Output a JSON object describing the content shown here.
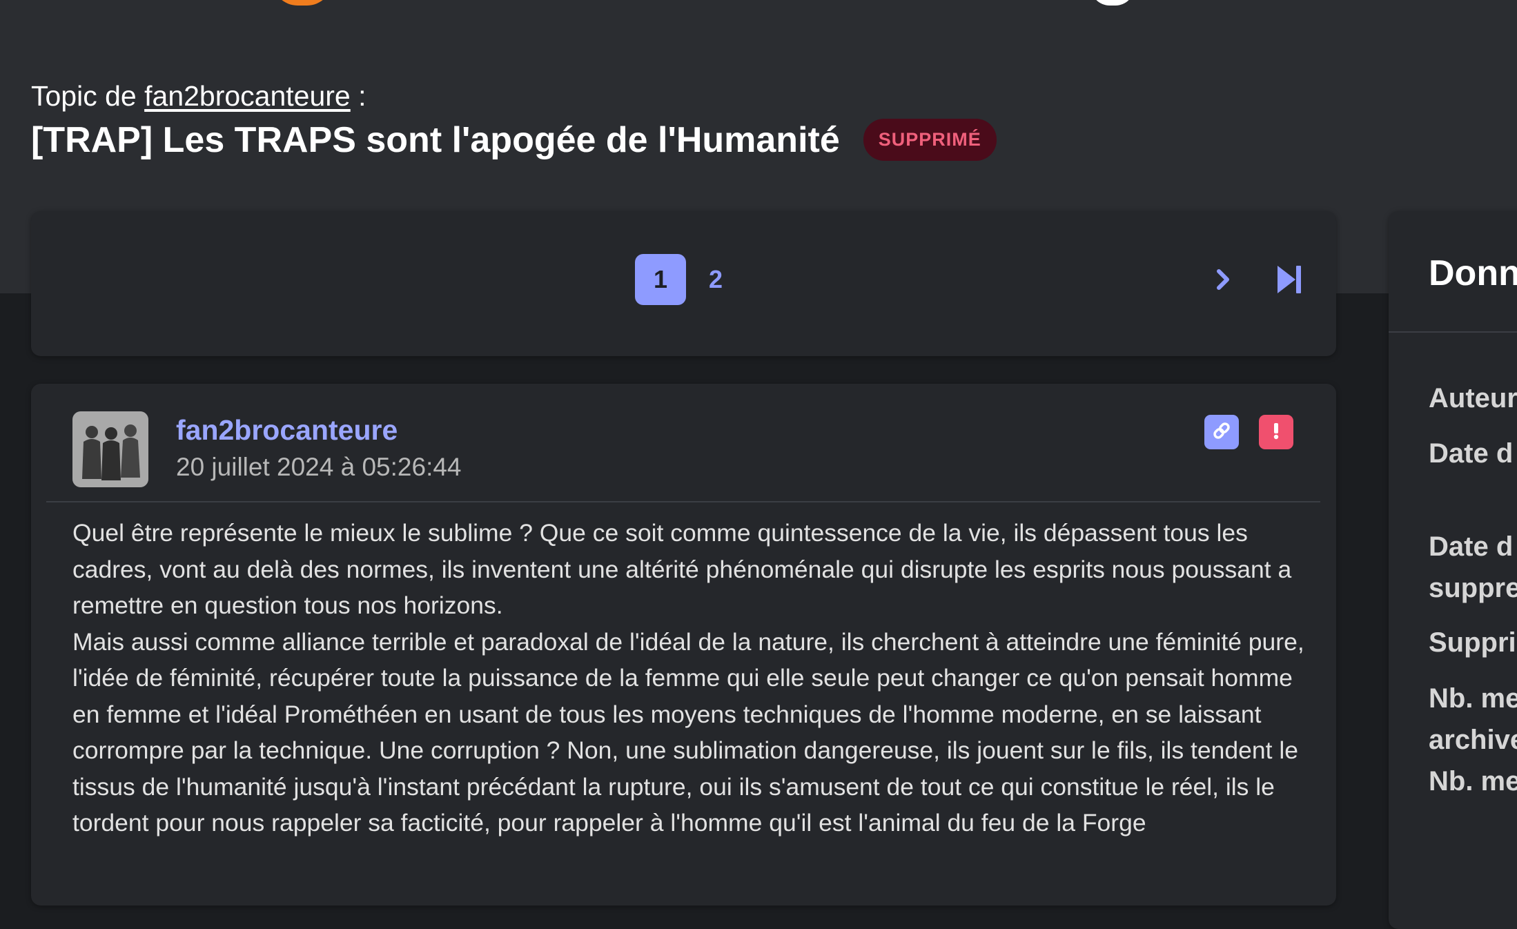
{
  "topic": {
    "author_prefix": "Topic de",
    "author": "fan2brocanteure",
    "author_suffix": ":",
    "title": "[TRAP] Les TRAPS sont l'apogée de l'Humanité",
    "status_badge": "SUPPRIMÉ"
  },
  "pagination": {
    "pages": [
      "1",
      "2"
    ],
    "current_page": "1",
    "next_icon": "chevron-right-icon",
    "last_icon": "skip-to-end-icon"
  },
  "post": {
    "author": "fan2brocanteure",
    "date": "20 juillet 2024 à 05:26:44",
    "paragraphs": [
      "Quel être représente le mieux le sublime ? Que ce soit comme quintessence de la vie, ils dépassent tous les cadres, vont au delà des normes, ils inventent une altérité phénoménale qui disrupte les esprits nous poussant a remettre en question tous nos horizons.",
      "Mais aussi comme alliance terrible et paradoxal de l'idéal de la nature, ils cherchent à atteindre une féminité pure, l'idée de féminité, récupérer toute la puissance de la femme qui elle seule peut changer ce qu'on pensait homme en femme et l'idéal Prométhéen en usant de tous les moyens techniques de l'homme moderne, en se laissant corrompre par la technique. Une corruption ? Non, une sublimation dangereuse, ils jouent sur le fils, ils tendent le tissus de l'humanité jusqu'à l'instant précédant la rupture, oui ils s'amusent de tout ce qui constitue le réel, ils le tordent pour nous rappeler sa facticité, pour rappeler à l'homme qu'il est l'animal du feu de la Forge"
    ],
    "link_icon": "link-icon",
    "report_icon": "exclamation-icon"
  },
  "sidebar": {
    "title": "Donn",
    "labels": [
      "Auteur",
      "Date d",
      "Date d",
      "suppre",
      "Suppri",
      "Nb. me",
      "archive",
      "Nb. me"
    ]
  },
  "colors": {
    "accent": "#8e9bff",
    "danger": "#f0506e",
    "badge_bg": "#4a0b1a",
    "header_bg": "#2b2d31",
    "page_bg": "#1b1d20",
    "card_bg": "#25272b"
  }
}
